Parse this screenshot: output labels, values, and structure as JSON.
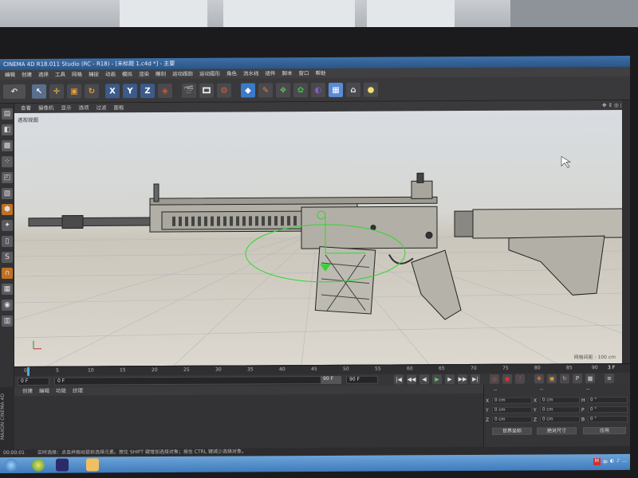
{
  "window": {
    "title": "CINEMA 4D R18.011 Studio (RC - R18) - [未标题 1.c4d *] - 主要"
  },
  "menubar": [
    "编辑",
    "创建",
    "选择",
    "工具",
    "网格",
    "捕捉",
    "动画",
    "模拟",
    "渲染",
    "雕刻",
    "运动跟踪",
    "运动图形",
    "角色",
    "流水线",
    "插件",
    "脚本",
    "窗口",
    "帮助"
  ],
  "toolbar": {
    "icons": [
      "undo-icon",
      "select-arrow-icon",
      "move-icon",
      "scale-icon",
      "rotate-icon",
      "x-axis-icon",
      "y-axis-icon",
      "z-axis-icon",
      "world-coord-icon",
      "render-view-icon",
      "render-picture-icon",
      "render-settings-icon",
      "cube-icon",
      "pen-icon",
      "subdivide-icon",
      "cloner-icon",
      "deformer-icon",
      "floor-icon",
      "camera-icon",
      "light-icon"
    ],
    "x_label": "X",
    "y_label": "Y",
    "z_label": "Z"
  },
  "viewport": {
    "menu": [
      "查看",
      "摄像机",
      "显示",
      "选项",
      "过滤",
      "面板"
    ],
    "label": "透视视图",
    "grid_info": "网格间距 : 100 cm"
  },
  "timeline": {
    "ticks": [
      "0",
      "5",
      "10",
      "15",
      "20",
      "25",
      "30",
      "35",
      "40",
      "45",
      "50",
      "55",
      "60",
      "65",
      "70",
      "75",
      "80",
      "85",
      "90"
    ],
    "end_frame": "3 F"
  },
  "controls": {
    "current_frame": "0 F",
    "start_field": "0 F",
    "end_field": "90 F",
    "max_field": "90 F"
  },
  "material_panel": {
    "menu": [
      "创建",
      "编辑",
      "功能",
      "纹理"
    ]
  },
  "coord_panel": {
    "header": [
      "--",
      "--",
      "--"
    ],
    "rows": [
      {
        "a": "X",
        "av": "0 cm",
        "b": "X",
        "bv": "0 cm",
        "c": "H",
        "cv": "0 °"
      },
      {
        "a": "Y",
        "av": "0 cm",
        "b": "Y",
        "bv": "0 cm",
        "c": "P",
        "cv": "0 °"
      },
      {
        "a": "Z",
        "av": "0 cm",
        "b": "Z",
        "bv": "0 cm",
        "c": "B",
        "cv": "0 °"
      }
    ],
    "world_dropdown": "世界坐标",
    "scale_dropdown": "绝对尺寸",
    "apply_button": "应用"
  },
  "statusbar": {
    "time": "00:00:01",
    "message": "实时选择：点击并拖动鼠标选择元素。按住 SHIFT 键增加选择对象；按住 CTRL 键减少选择对象。"
  },
  "side_logo": "MAXON CINEMA 4D",
  "taskbar": {
    "tray": [
      "M",
      "中",
      "◐",
      "♪",
      "…"
    ]
  }
}
